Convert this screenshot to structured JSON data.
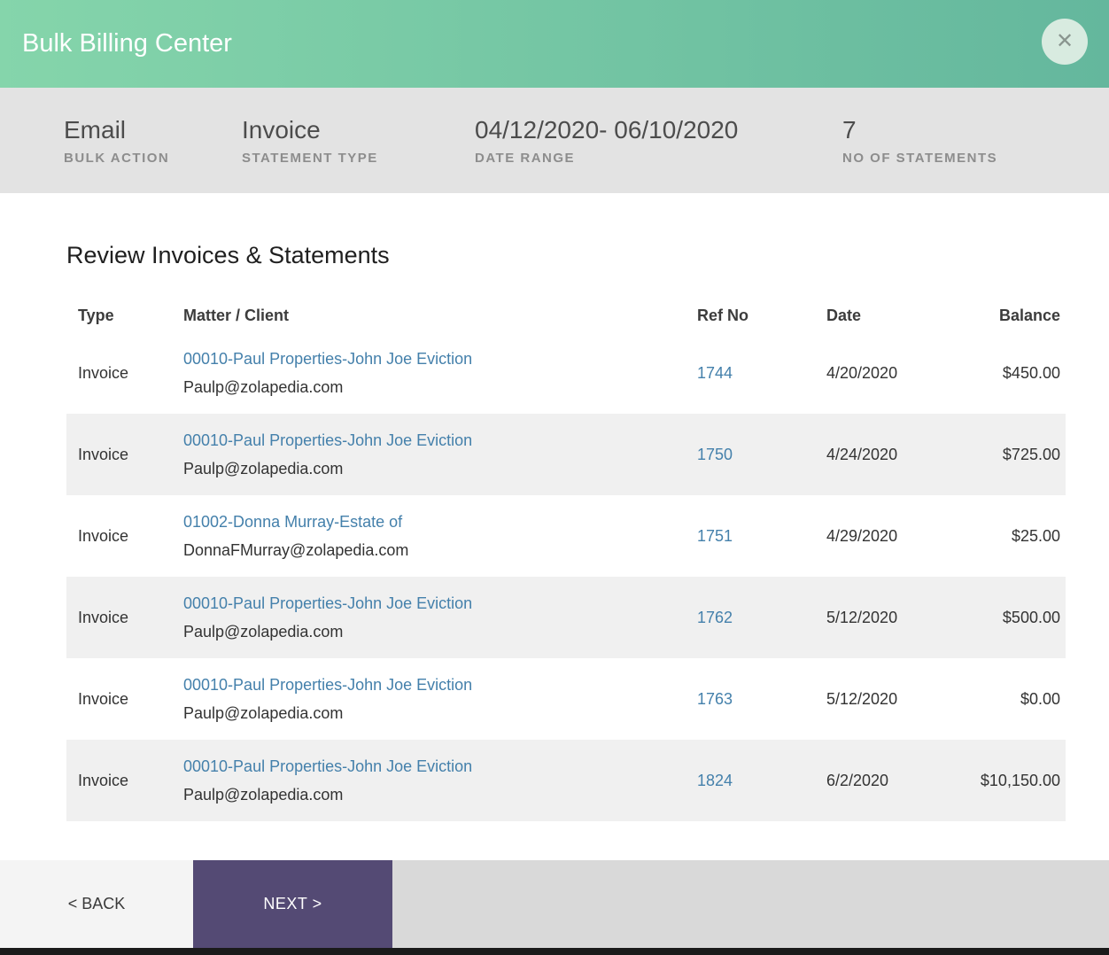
{
  "modal": {
    "title": "Bulk Billing Center",
    "close_icon": "✕"
  },
  "summary": {
    "items": [
      {
        "value": "Email",
        "label": "BULK ACTION"
      },
      {
        "value": "Invoice",
        "label": "STATEMENT TYPE"
      },
      {
        "value": "04/12/2020- 06/10/2020",
        "label": "DATE RANGE"
      },
      {
        "value": "7",
        "label": "NO OF STATEMENTS"
      }
    ]
  },
  "review": {
    "heading": "Review Invoices & Statements",
    "table": {
      "columns": [
        "Type",
        "Matter / Client",
        "Ref No",
        "Date",
        "Balance"
      ],
      "rows": [
        {
          "type": "Invoice",
          "matter": "00010-Paul Properties-John Joe Eviction",
          "email": "Paulp@zolapedia.com",
          "ref_no": "1744",
          "date": "4/20/2020",
          "balance": "$450.00"
        },
        {
          "type": "Invoice",
          "matter": "00010-Paul Properties-John Joe Eviction",
          "email": "Paulp@zolapedia.com",
          "ref_no": "1750",
          "date": "4/24/2020",
          "balance": "$725.00"
        },
        {
          "type": "Invoice",
          "matter": "01002-Donna Murray-Estate of",
          "email": "DonnaFMurray@zolapedia.com",
          "ref_no": "1751",
          "date": "4/29/2020",
          "balance": "$25.00"
        },
        {
          "type": "Invoice",
          "matter": "00010-Paul Properties-John Joe Eviction",
          "email": "Paulp@zolapedia.com",
          "ref_no": "1762",
          "date": "5/12/2020",
          "balance": "$500.00"
        },
        {
          "type": "Invoice",
          "matter": "00010-Paul Properties-John Joe Eviction",
          "email": "Paulp@zolapedia.com",
          "ref_no": "1763",
          "date": "5/12/2020",
          "balance": "$0.00"
        },
        {
          "type": "Invoice",
          "matter": "00010-Paul Properties-John Joe Eviction",
          "email": "Paulp@zolapedia.com",
          "ref_no": "1824",
          "date": "6/2/2020",
          "balance": "$10,150.00"
        }
      ]
    }
  },
  "footer": {
    "back_label": "< BACK",
    "next_label": "NEXT >"
  },
  "colors": {
    "header_gradient_start": "#85d5ab",
    "header_gradient_end": "#64b79d",
    "link": "#4480ab",
    "next_button": "#544a74",
    "row_alt": "#f0f0f0"
  }
}
